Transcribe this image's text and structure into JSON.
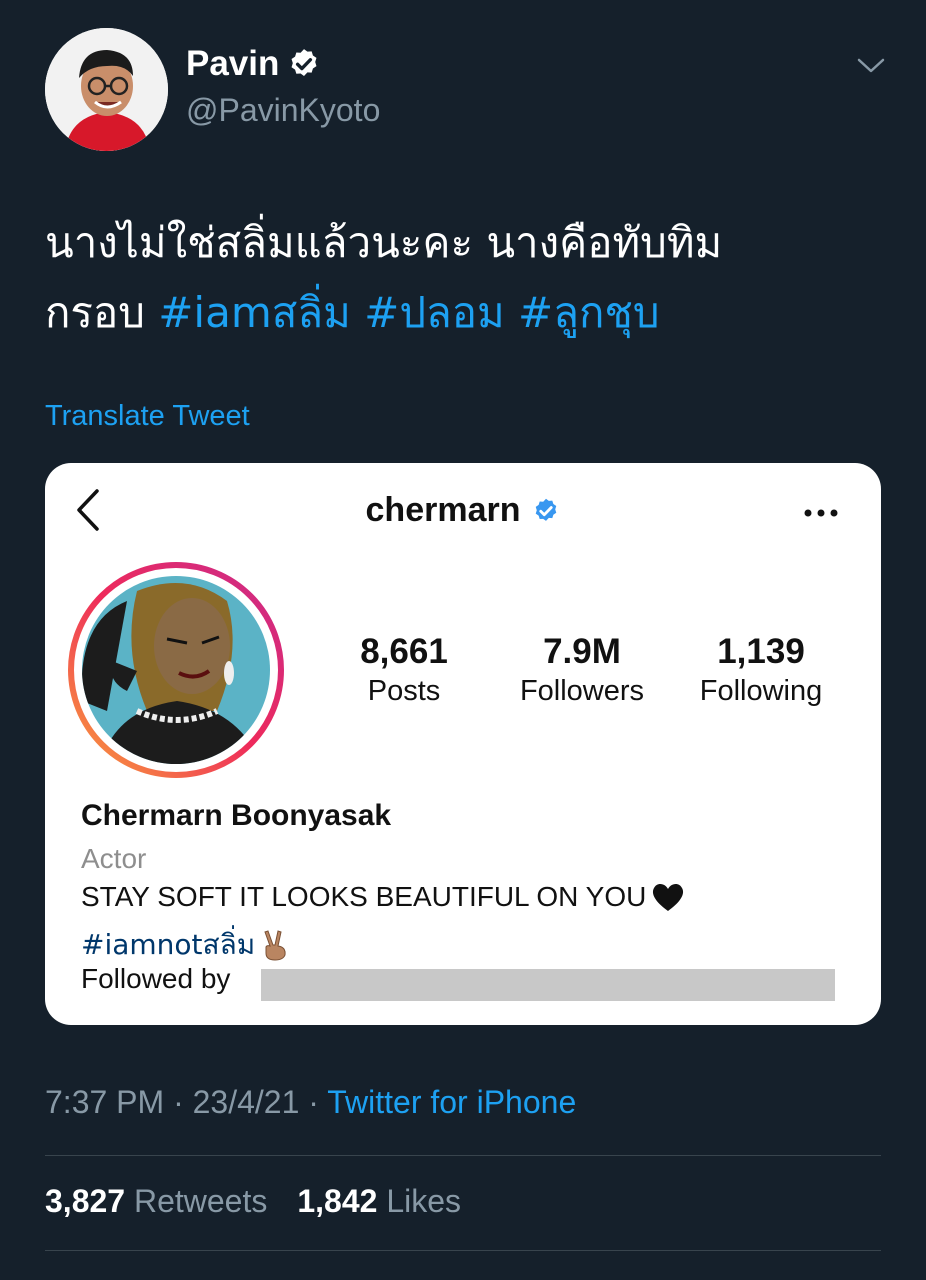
{
  "author": {
    "name": "Pavin",
    "handle": "@PavinKyoto",
    "verified": true
  },
  "tweet": {
    "text_line1": "นางไม่ใช่สลิ่มแล้วนะคะ นางคือทับทิม",
    "text_line2_plain": "กรอบ ",
    "hashtags": [
      "#iamสลิ่ม",
      "#ปลอม",
      "#ลูกชุบ"
    ],
    "translate_label": "Translate Tweet"
  },
  "instagram_card": {
    "username": "chermarn",
    "stats": [
      {
        "value": "8,661",
        "label": "Posts"
      },
      {
        "value": "7.9M",
        "label": "Followers"
      },
      {
        "value": "1,139",
        "label": "Following"
      }
    ],
    "full_name": "Chermarn Boonyasak",
    "category": "Actor",
    "bio": "STAY SOFT IT LOOKS BEAUTIFUL ON YOU",
    "bio_hashtag": "#iamnotสลิ่ม",
    "followed_by": "Followed by"
  },
  "meta": {
    "time": "7:37 PM",
    "separator": "·",
    "date": "23/4/21",
    "source": "Twitter for iPhone"
  },
  "engagement": {
    "retweets_count": "3,827",
    "retweets_label": "Retweets",
    "likes_count": "1,842",
    "likes_label": "Likes"
  },
  "colors": {
    "background": "#15202b",
    "accent": "#1da1f2",
    "muted": "#8899a6",
    "ig_verified": "#3897f0"
  }
}
